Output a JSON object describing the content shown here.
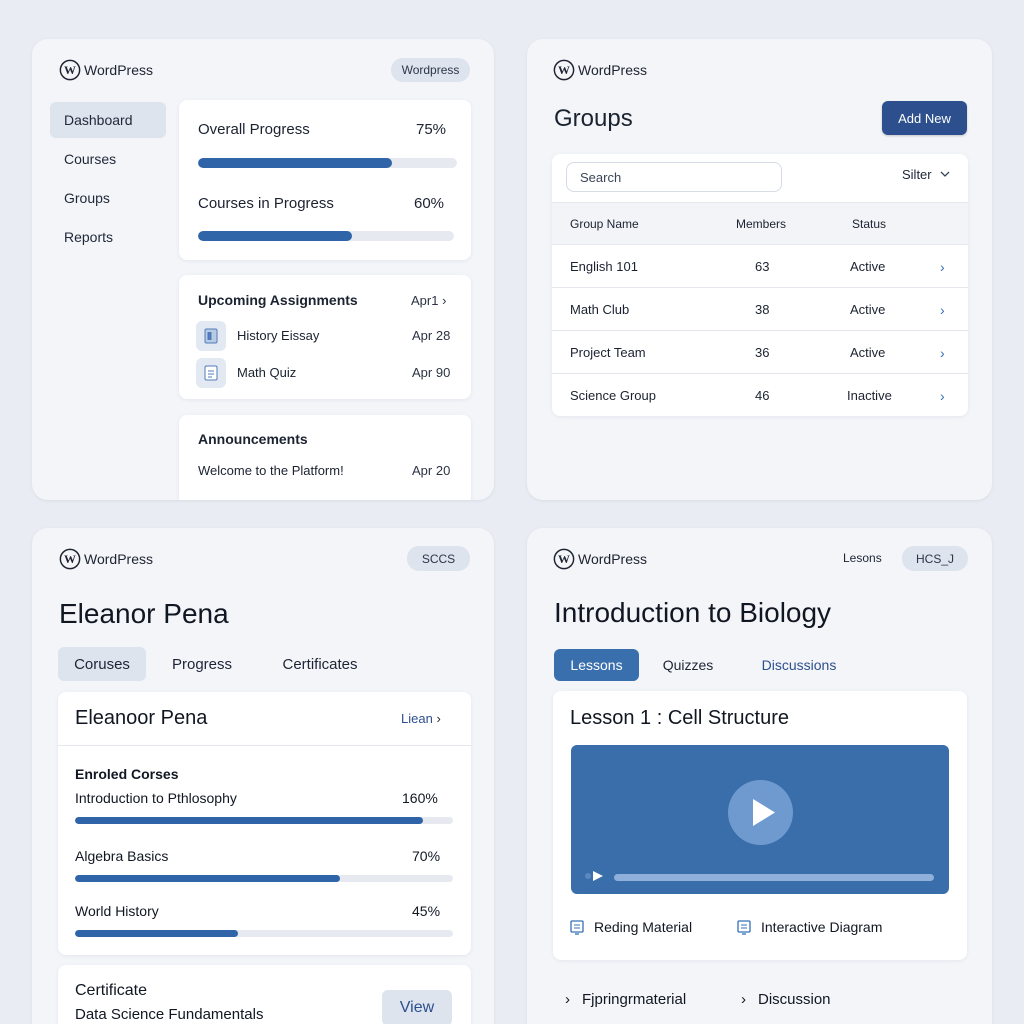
{
  "brand": "WordPress",
  "dashboard": {
    "badge": "Wordpress",
    "nav": [
      "Dashboard",
      "Courses",
      "Groups",
      "Reports"
    ],
    "overall_progress": {
      "label": "Overall Progress",
      "value_text": "75%",
      "fraction": 0.75
    },
    "courses_in_progress": {
      "label": "Courses in Progress",
      "value_text": "60%",
      "fraction": 0.6
    },
    "assignments": {
      "title": "Upcoming Assignments",
      "date_link": "Apr1",
      "items": [
        {
          "name": "History Eissay",
          "date": "Apr 28"
        },
        {
          "name": "Math Quiz",
          "date": "Apr 90"
        }
      ]
    },
    "announcements": {
      "title": "Announcements",
      "item": "Welcome to the Platform!",
      "date": "Apr 20"
    }
  },
  "groups": {
    "title": "Groups",
    "add_button": "Add New",
    "search_placeholder": "Search",
    "filter_label": "Silter",
    "columns": [
      "Group Name",
      "Members",
      "Status"
    ],
    "rows": [
      {
        "name": "English 101",
        "members": "63",
        "status": "Active"
      },
      {
        "name": "Math Club",
        "members": "38",
        "status": "Active"
      },
      {
        "name": "Project Team",
        "members": "36",
        "status": "Active"
      },
      {
        "name": "Science Group",
        "members": "46",
        "status": "Inactive"
      }
    ]
  },
  "profile": {
    "badge": "SCCS",
    "name": "Eleanor Pena",
    "tabs": [
      "Coruses",
      "Progress",
      "Certificates"
    ],
    "card_name": "Eleanoor Pena",
    "card_link": "Liean",
    "enrolled_label": "Enroled Corses",
    "courses": [
      {
        "name": "Introduction to Pthlosophy",
        "value_text": "160%",
        "fraction": 0.92
      },
      {
        "name": "Algebra Basics",
        "value_text": "70%",
        "fraction": 0.7
      },
      {
        "name": "World History",
        "value_text": "45%",
        "fraction": 0.43
      }
    ],
    "certificate_label": "Certificate",
    "certificate_course": "Data Science Fundamentals",
    "view_button": "View"
  },
  "course": {
    "lessons_link": "Lesons",
    "badge": "HCS_J",
    "title": "Introduction to Biology",
    "tabs": [
      "Lessons",
      "Quizzes",
      "Discussions"
    ],
    "lesson_title": "Lesson 1 : Cell Structure",
    "resources": [
      "Reding Material",
      "Interactive Diagram"
    ],
    "links": [
      "Fjpringrmaterial",
      "Discussion"
    ]
  },
  "colors": {
    "accent": "#2f64a8",
    "button": "#2d4f8e",
    "tab_active": "#3a6fae",
    "video": "#3a6eaa"
  }
}
